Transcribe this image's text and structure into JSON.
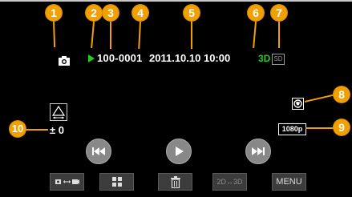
{
  "callouts": [
    "1",
    "2",
    "3",
    "4",
    "5",
    "6",
    "7",
    "8",
    "9",
    "10"
  ],
  "playback": {
    "mode_icon": "still-camera-icon",
    "play_indicator": "green-play-icon",
    "folder_file": "100-0001",
    "datetime": "2011.10.10 10:00",
    "badge_3d": "3D",
    "media_badge": "SD",
    "gps_icon": "gps-icon",
    "resolution": "1080p",
    "parallax_icon": "parallax-adjust-icon",
    "parallax_value": "± 0"
  },
  "controls": {
    "prev_icon": "skip-back-icon",
    "play_icon": "play-icon",
    "next_icon": "skip-forward-icon"
  },
  "toolbar": {
    "mode_switch_icon": "mode-switch-icon",
    "index_icon": "index-grid-icon",
    "delete_icon": "trash-icon",
    "switch_2d3d_label": "2D↔3D",
    "menu_label": "MENU"
  },
  "colors": {
    "callout": "#F0A000",
    "indicator_green": "#22CC22"
  }
}
